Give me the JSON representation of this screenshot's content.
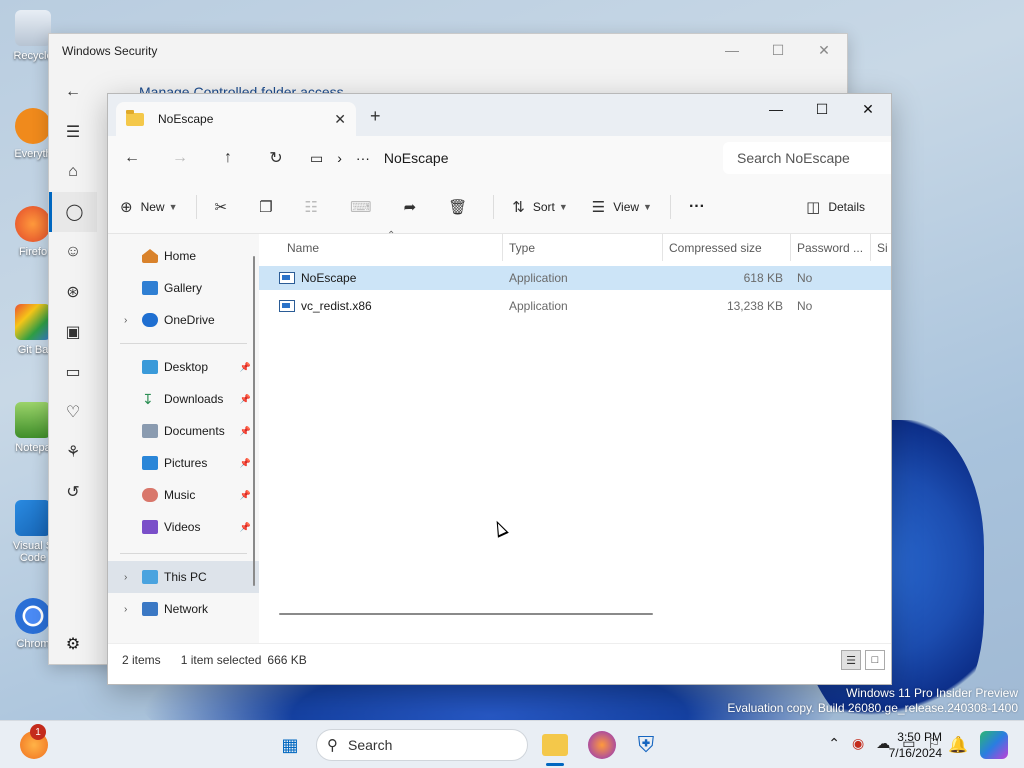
{
  "desktop": {
    "icons": [
      {
        "label": "Recycle"
      },
      {
        "label": "Everyth"
      },
      {
        "label": "Firefo"
      },
      {
        "label": "Git Ba"
      },
      {
        "label": "Notepa"
      },
      {
        "label": "Visual S Code"
      },
      {
        "label": "Chrom"
      }
    ]
  },
  "security_window": {
    "title": "Windows Security",
    "heading": "Manage Controlled folder access"
  },
  "explorer": {
    "tab_title": "NoEscape",
    "breadcrumb": {
      "ellipsis": "···",
      "current": "NoEscape"
    },
    "search_placeholder": "Search NoEscape",
    "toolbar": {
      "new_label": "New",
      "sort_label": "Sort",
      "view_label": "View",
      "more_label": "···",
      "details_label": "Details"
    },
    "nav": {
      "home": "Home",
      "gallery": "Gallery",
      "onedrive": "OneDrive",
      "desktop": "Desktop",
      "downloads": "Downloads",
      "documents": "Documents",
      "pictures": "Pictures",
      "music": "Music",
      "videos": "Videos",
      "thispc": "This PC",
      "network": "Network"
    },
    "columns": {
      "name": "Name",
      "type": "Type",
      "size": "Compressed size",
      "password": "Password ...",
      "si": "Si"
    },
    "files": [
      {
        "name": "NoEscape",
        "type": "Application",
        "size": "618 KB",
        "password": "No",
        "selected": true
      },
      {
        "name": "vc_redist.x86",
        "type": "Application",
        "size": "13,238 KB",
        "password": "No",
        "selected": false
      }
    ],
    "status": {
      "items": "2 items",
      "selected": "1 item selected",
      "size": "666 KB"
    }
  },
  "watermark": {
    "line1": "Windows 11 Pro Insider Preview",
    "line2": "Evaluation copy. Build 26080.ge_release.240308-1400"
  },
  "taskbar": {
    "search_label": "Search",
    "notification_count": "1",
    "time": "3:50 PM",
    "date": "7/16/2024"
  }
}
